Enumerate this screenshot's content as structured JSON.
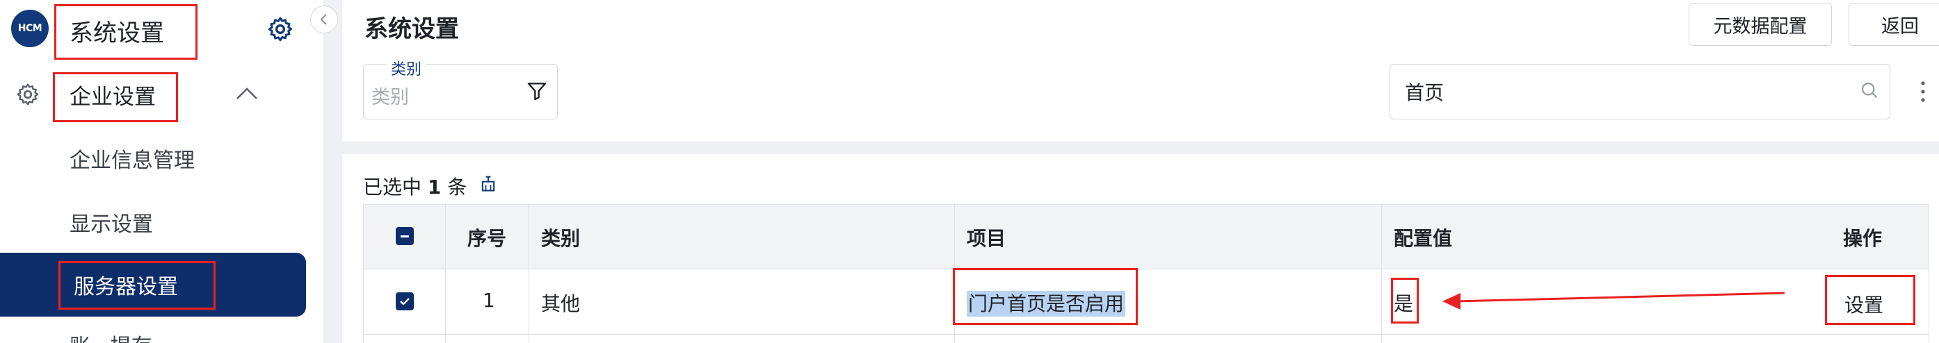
{
  "sidebar": {
    "logo_text": "HCM",
    "app_title": "系统设置",
    "group_label": "企业设置",
    "items": [
      {
        "label": "企业信息管理"
      },
      {
        "label": "显示设置"
      },
      {
        "label": "服务器设置"
      },
      {
        "label": "账...提存..."
      }
    ]
  },
  "header": {
    "title": "系统设置",
    "metadata_button": "元数据配置",
    "back_button": "返回"
  },
  "filters": {
    "category_legend": "类别",
    "category_placeholder": "类别",
    "search_value": "首页"
  },
  "table": {
    "selected_prefix": "已选中",
    "selected_count": "1",
    "selected_suffix": "条",
    "columns": [
      "序号",
      "类别",
      "项目",
      "配置值",
      "操作"
    ],
    "rows": [
      {
        "index": "1",
        "category": "其他",
        "item": "门户首页是否启用",
        "value": "是",
        "action": "设置"
      }
    ]
  },
  "colors": {
    "accent": "#0e2d6b",
    "annotation_red": "#e8201f",
    "highlight": "#b9d3f2"
  }
}
